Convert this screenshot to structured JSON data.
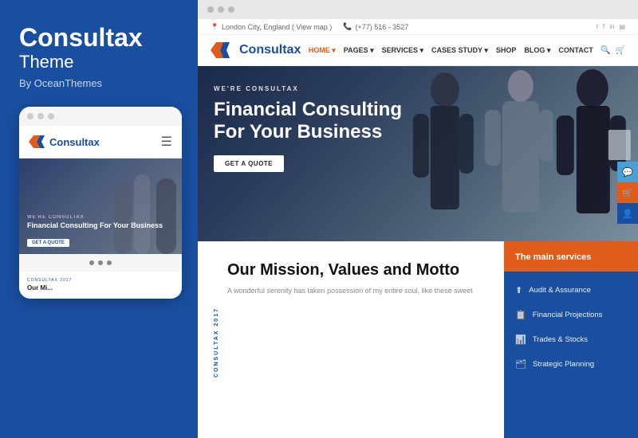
{
  "left": {
    "title": "Consultax",
    "subtitle": "Theme",
    "by": "By OceanThemes"
  },
  "mobile": {
    "logo_text": "Consultax",
    "we_are": "WE'RE CONSULTAX",
    "headline": "Financial Consulting For Your Business",
    "btn": "GET A QUOTE",
    "mission_label": "CONSULTAX 2017",
    "mission_title": "Our Mis...",
    "dots": [
      "●",
      "●",
      "●"
    ]
  },
  "browser": {
    "dots": [
      "●",
      "●",
      "●"
    ]
  },
  "topbar": {
    "location": "London City, England ( View map )",
    "phone": "(+77) 516 - 3527"
  },
  "nav": {
    "logo": "Consultax",
    "items": [
      {
        "label": "HOME",
        "active": true,
        "has_dropdown": true
      },
      {
        "label": "PAGES",
        "active": false,
        "has_dropdown": true
      },
      {
        "label": "SERVICES",
        "active": false,
        "has_dropdown": true
      },
      {
        "label": "CASES STUDY",
        "active": false,
        "has_dropdown": true
      },
      {
        "label": "SHOP",
        "active": false,
        "has_dropdown": false
      },
      {
        "label": "BLOG",
        "active": false,
        "has_dropdown": true
      },
      {
        "label": "CONTACT",
        "active": false,
        "has_dropdown": false
      }
    ]
  },
  "hero": {
    "label": "WE'RE CONSULTAX",
    "title": "Financial Consulting For Your Business",
    "cta": "GET A QUOTE"
  },
  "mission": {
    "label": "CONSULTAX 2017",
    "title": "Our Mission, Values and Motto",
    "text": "A wonderful serenity has taken possession of my entire soul, like these sweet"
  },
  "services": {
    "header": "The main services",
    "items": [
      {
        "icon": "⬆",
        "label": "Audit & Assurance"
      },
      {
        "icon": "📋",
        "label": "Financial Projections"
      },
      {
        "icon": "📊",
        "label": "Trades & Stocks"
      },
      {
        "icon": "🗂",
        "label": "Strategic Planning"
      }
    ]
  },
  "floating": {
    "chat_icon": "💬",
    "cart_icon": "🛒",
    "user_icon": "👤"
  }
}
